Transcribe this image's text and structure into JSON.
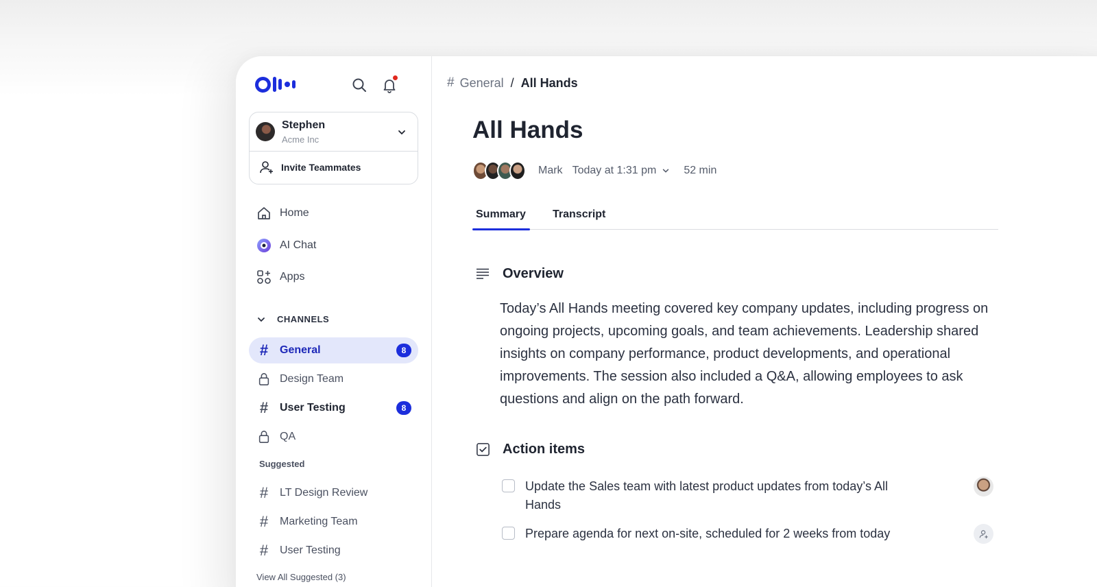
{
  "sidebar": {
    "user": {
      "name": "Stephen",
      "org": "Acme Inc"
    },
    "invite_label": "Invite Teammates",
    "nav": [
      {
        "label": "Home",
        "icon": "home-icon"
      },
      {
        "label": "AI Chat",
        "icon": "ai-chat-icon"
      },
      {
        "label": "Apps",
        "icon": "apps-icon"
      }
    ],
    "channels_label": "CHANNELS",
    "channels": [
      {
        "label": "General",
        "icon": "hash-icon",
        "badge": "8",
        "active": true
      },
      {
        "label": "Design Team",
        "icon": "lock-icon"
      },
      {
        "label": "User Testing",
        "icon": "hash-icon",
        "badge": "8"
      },
      {
        "label": "QA",
        "icon": "lock-icon"
      }
    ],
    "suggested_label": "Suggested",
    "suggested": [
      {
        "label": "LT Design Review",
        "icon": "hash-icon"
      },
      {
        "label": "Marketing Team",
        "icon": "hash-icon"
      },
      {
        "label": "User Testing",
        "icon": "hash-icon"
      }
    ],
    "view_all_label": "View All Suggested (3)"
  },
  "main": {
    "breadcrumb": {
      "hash": "#",
      "channel": "General",
      "separator": "/",
      "current": "All Hands"
    },
    "title": "All Hands",
    "meta": {
      "owner": "Mark",
      "when": "Today at 1:31 pm",
      "duration": "52 min"
    },
    "tabs": [
      {
        "label": "Summary",
        "active": true
      },
      {
        "label": "Transcript"
      }
    ],
    "overview": {
      "heading": "Overview",
      "text": "Today’s All Hands meeting covered key company updates, including progress on ongoing projects, upcoming goals, and team achievements. Leadership shared insights on company performance, product developments, and operational improvements. The session also included a Q&A, allowing employees to ask questions and align on the path forward."
    },
    "action_items": {
      "heading": "Action items",
      "items": [
        {
          "text": "Update the Sales team with latest product updates from today’s All Hands",
          "assignee": "avatar"
        },
        {
          "text": "Prepare agenda for next on-site, scheduled for 2 weeks from today",
          "assignee": "add-assignee-icon"
        }
      ]
    }
  },
  "colors": {
    "accent": "#1c2edc",
    "active_bg": "#e3e7fb",
    "notification": "#e0281e"
  }
}
